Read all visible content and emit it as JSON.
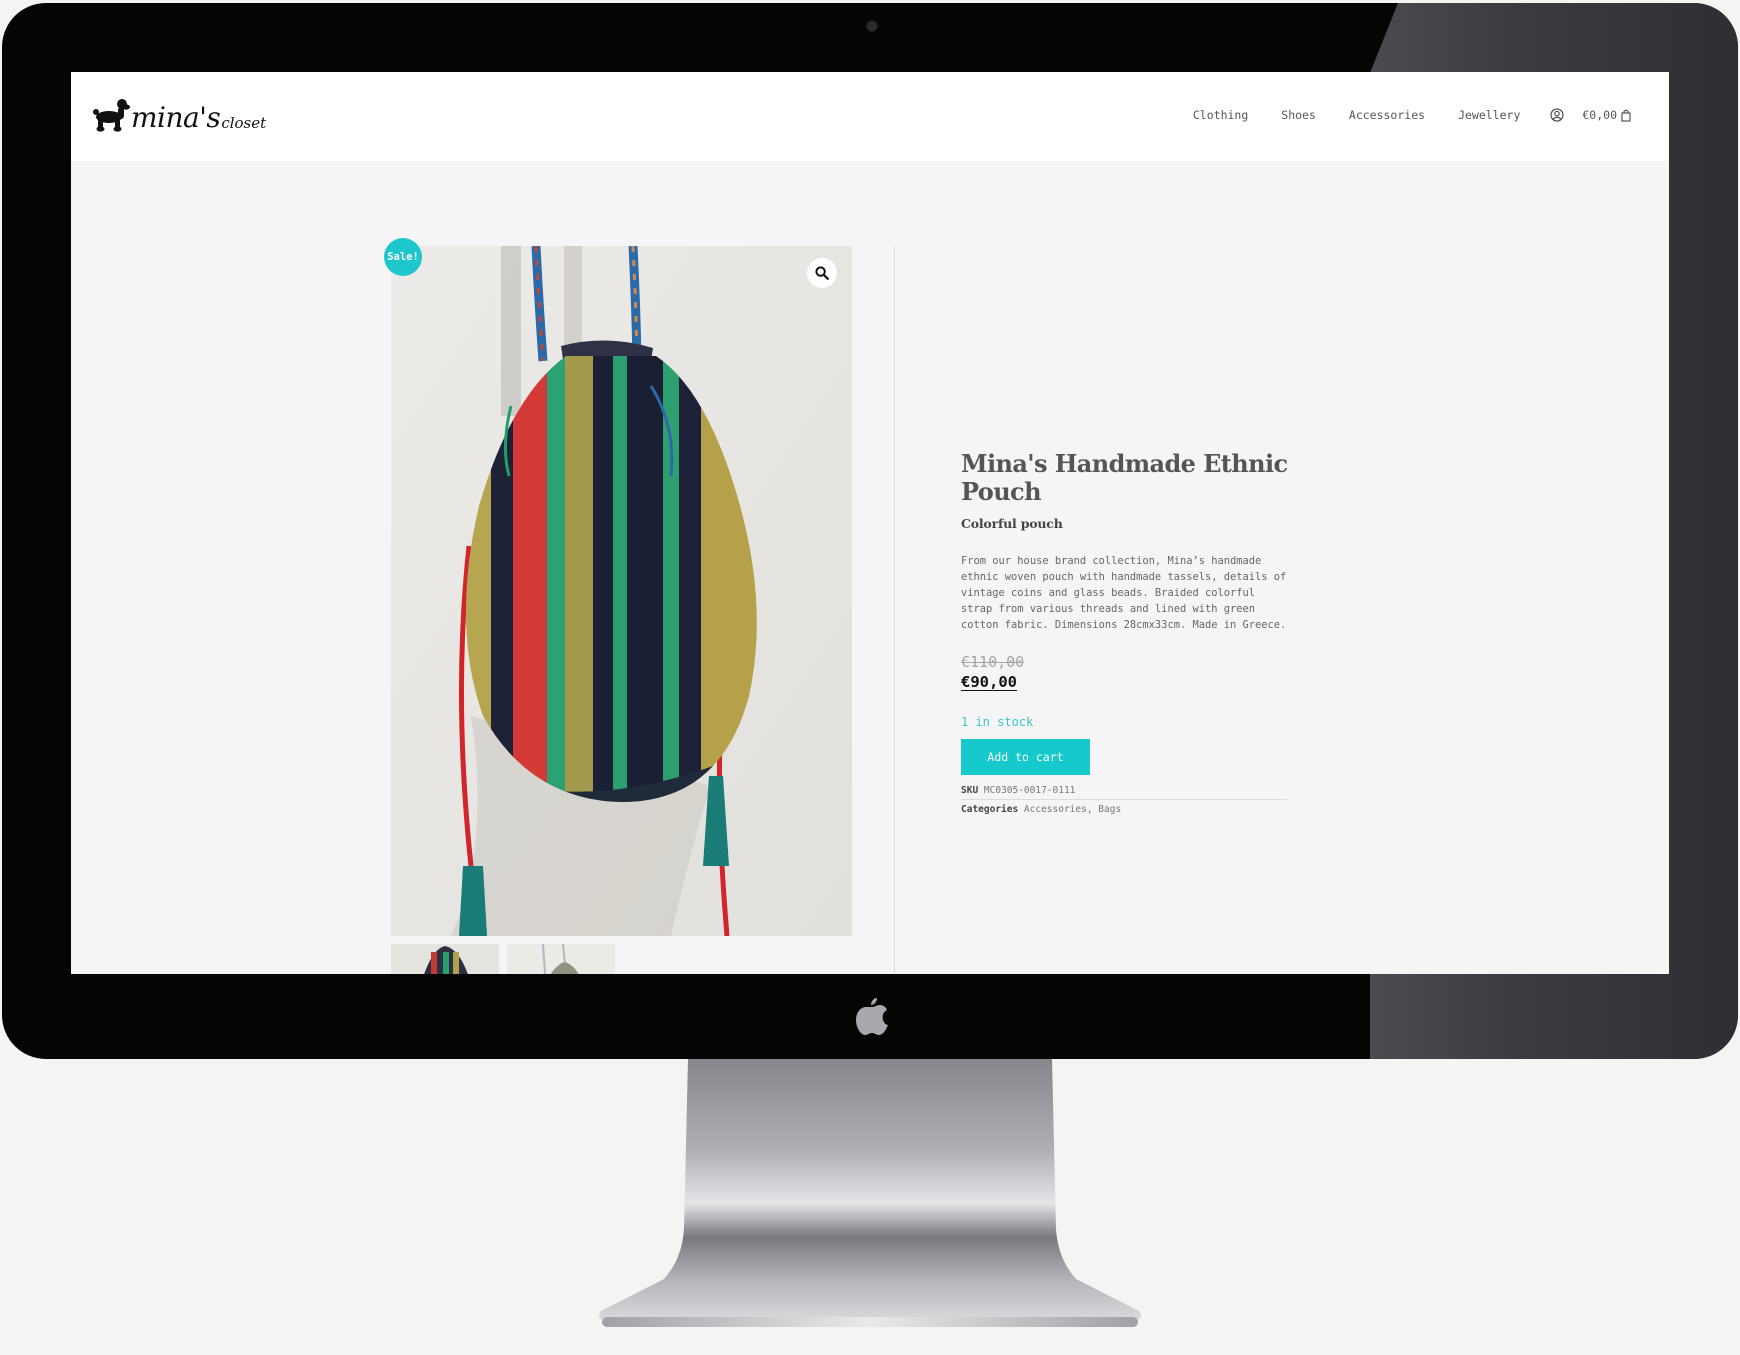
{
  "site": {
    "logo_main": "mina's",
    "logo_sub": "closet",
    "nav": [
      {
        "label": "Clothing"
      },
      {
        "label": "Shoes"
      },
      {
        "label": "Accessories"
      },
      {
        "label": "Jewellery"
      }
    ],
    "account_icon": "user-circle-icon",
    "cart_total": "€0,00",
    "cart_icon": "shopping-bag-icon"
  },
  "product": {
    "badge": "Sale!",
    "zoom_icon": "magnifier-icon",
    "title": "Mina's Handmade Ethnic Pouch",
    "subtitle": "Colorful pouch",
    "description": "From our house brand collection, Mina’s handmade ethnic woven pouch with handmade tassels, details of vintage coins and glass beads. Braided colorful strap from various threads and lined with green cotton fabric. Dimensions 28cmx33cm. Made in Greece.",
    "regular_price": "€110,00",
    "sale_price": "€90,00",
    "stock": "1 in stock",
    "add_to_cart": "Add to cart",
    "sku_label": "SKU",
    "sku": "MC0305-0017-0111",
    "categories_label": "Categories",
    "categories": [
      "Accessories",
      "Bags"
    ],
    "categories_separator": ", "
  },
  "colors": {
    "accent": "#16c9cd",
    "stock_text": "#3ac3c9",
    "page_bg": "#f5f5f5",
    "header_bg": "#ffffff"
  },
  "device": {
    "type": "iMac mockup",
    "logo_icon": "apple-logo-icon",
    "camera_icon": "camera-icon"
  }
}
